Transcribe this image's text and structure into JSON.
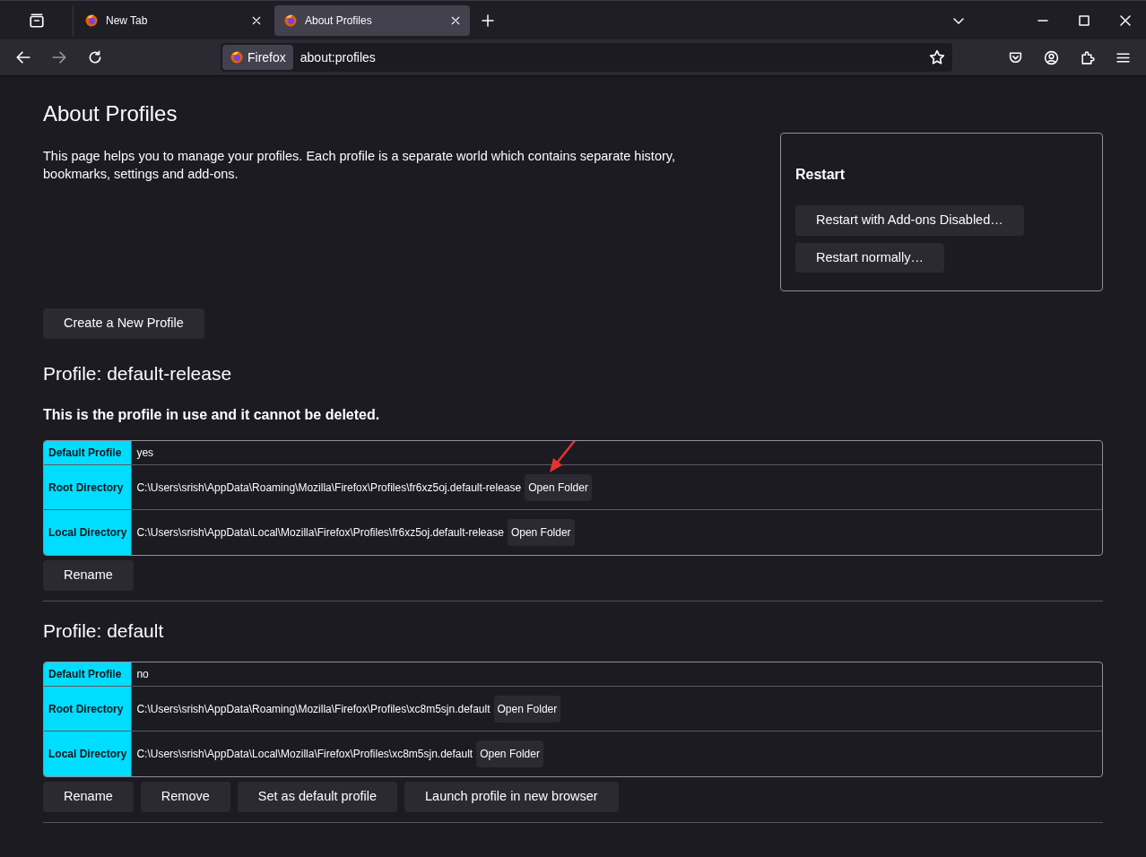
{
  "tabs": [
    {
      "label": "New Tab",
      "selected": false
    },
    {
      "label": "About Profiles",
      "selected": true
    }
  ],
  "address_bar": {
    "identity": "Firefox",
    "url": "about:profiles"
  },
  "page": {
    "title": "About Profiles",
    "intro": "This page helps you to manage your profiles. Each profile is a separate world which contains separate history, bookmarks, settings and add-ons.",
    "restart": {
      "title": "Restart",
      "buttons": [
        "Restart with Add-ons Disabled…",
        "Restart normally…"
      ]
    },
    "create_button": "Create a New Profile",
    "profiles": [
      {
        "title": "Profile: default-release",
        "note": "This is the profile in use and it cannot be deleted.",
        "rows": [
          {
            "label": "Default Profile",
            "value": "yes"
          },
          {
            "label": "Root Directory",
            "value": "C:\\Users\\srish\\AppData\\Roaming\\Mozilla\\Firefox\\Profiles\\fr6xz5oj.default-release",
            "button": "Open Folder"
          },
          {
            "label": "Local Directory",
            "value": "C:\\Users\\srish\\AppData\\Local\\Mozilla\\Firefox\\Profiles\\fr6xz5oj.default-release",
            "button": "Open Folder"
          }
        ],
        "buttons": [
          "Rename"
        ]
      },
      {
        "title": "Profile: default",
        "rows": [
          {
            "label": "Default Profile",
            "value": "no"
          },
          {
            "label": "Root Directory",
            "value": "C:\\Users\\srish\\AppData\\Roaming\\Mozilla\\Firefox\\Profiles\\xc8m5sjn.default",
            "button": "Open Folder"
          },
          {
            "label": "Local Directory",
            "value": "C:\\Users\\srish\\AppData\\Local\\Mozilla\\Firefox\\Profiles\\xc8m5sjn.default",
            "button": "Open Folder"
          }
        ],
        "buttons": [
          "Rename",
          "Remove",
          "Set as default profile",
          "Launch profile in new browser"
        ]
      }
    ]
  }
}
